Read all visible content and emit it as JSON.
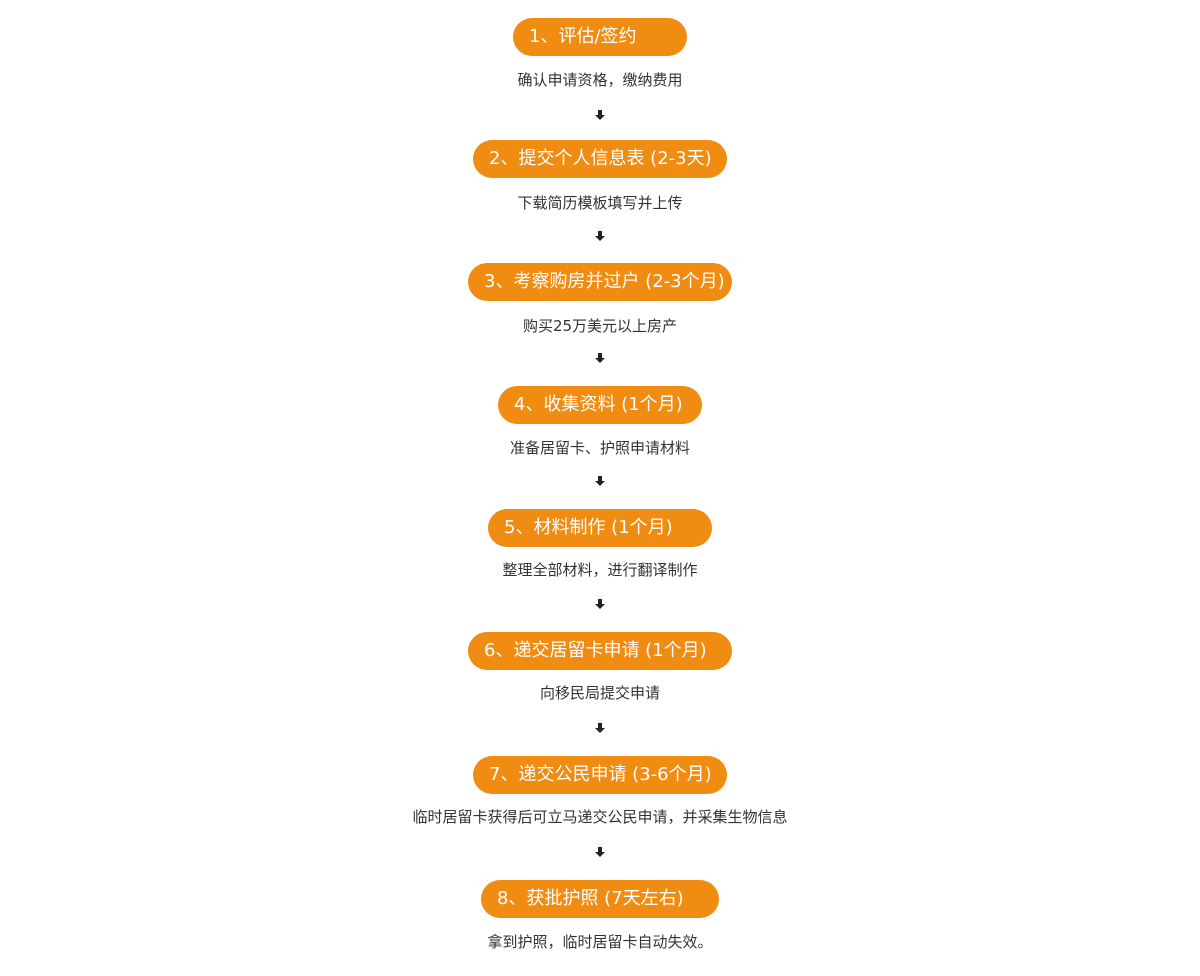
{
  "steps": [
    {
      "title": "1、评估/签约",
      "desc": "确认申请资格，缴纳费用"
    },
    {
      "title": "2、提交个人信息表 (2-3天)",
      "desc": "下载简历模板填写并上传"
    },
    {
      "title": "3、考察购房并过户 (2-3个月)",
      "desc": "购买25万美元以上房产"
    },
    {
      "title": "4、收集资料 (1个月)",
      "desc": "准备居留卡、护照申请材料"
    },
    {
      "title": "5、材料制作 (1个月)",
      "desc": "整理全部材料，进行翻译制作"
    },
    {
      "title": "6、递交居留卡申请 (1个月)",
      "desc": "向移民局提交申请"
    },
    {
      "title": "7、递交公民申请 (3-6个月)",
      "desc": "临时居留卡获得后可立马递交公民申请，并采集生物信息"
    },
    {
      "title": "8、获批护照 (7天左右)",
      "desc": "拿到护照，临时居留卡自动失效。"
    }
  ],
  "colors": {
    "accent": "#f08c12",
    "text": "#333333",
    "arrow": "#222222"
  }
}
